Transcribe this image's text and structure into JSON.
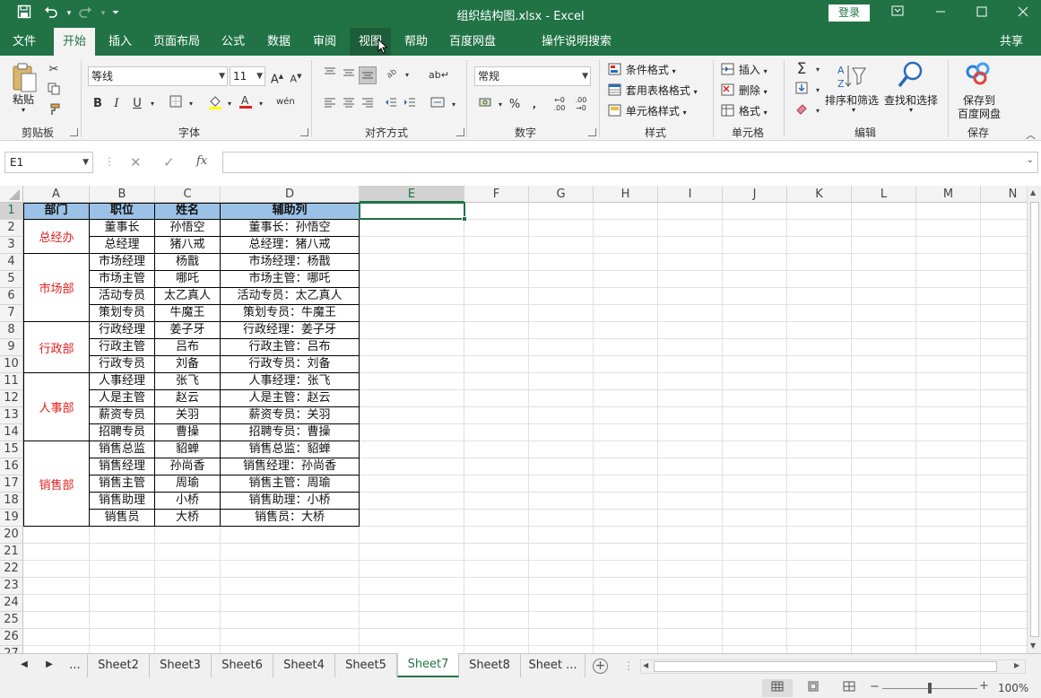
{
  "titlebar": {
    "title": "组织结构图.xlsx  -  Excel",
    "login_label": "登录",
    "save_icon": "save-icon",
    "undo_icon": "undo-icon",
    "redo_icon": "redo-icon"
  },
  "tabs": [
    {
      "label": "文件"
    },
    {
      "label": "开始"
    },
    {
      "label": "插入"
    },
    {
      "label": "页面布局"
    },
    {
      "label": "公式"
    },
    {
      "label": "数据"
    },
    {
      "label": "审阅"
    },
    {
      "label": "视图"
    },
    {
      "label": "帮助"
    },
    {
      "label": "百度网盘"
    },
    {
      "label": "操作说明搜索"
    }
  ],
  "share_label": "共享",
  "ribbon": {
    "clipboard": {
      "paste": "粘贴",
      "group": "剪贴板"
    },
    "font": {
      "name": "等线",
      "size": "11",
      "bold": "B",
      "italic": "I",
      "underline": "U",
      "group": "字体"
    },
    "alignment": {
      "group": "对齐方式"
    },
    "number": {
      "format": "常规",
      "group": "数字"
    },
    "styles": {
      "conditional": "条件格式",
      "table": "套用表格格式",
      "cell": "单元格样式",
      "group": "样式"
    },
    "cells": {
      "insert": "插入",
      "delete": "删除",
      "format": "格式",
      "group": "单元格"
    },
    "editing": {
      "sort": "排序和筛选",
      "find": "查找和选择",
      "group": "编辑"
    },
    "save": {
      "label1": "保存到",
      "label2": "百度网盘",
      "group": "保存"
    }
  },
  "formulabar": {
    "namebox": "E1",
    "value": ""
  },
  "columns": [
    "A",
    "B",
    "C",
    "D",
    "E",
    "F",
    "G",
    "H",
    "I",
    "J",
    "K",
    "L",
    "M",
    "N"
  ],
  "rows": [
    "1",
    "2",
    "3",
    "4",
    "5",
    "6",
    "7",
    "8",
    "9",
    "10",
    "11",
    "12",
    "13",
    "14",
    "15",
    "16",
    "17",
    "18",
    "19",
    "20",
    "21",
    "22",
    "23",
    "24",
    "25",
    "26",
    "27"
  ],
  "table": {
    "headers": [
      "部门",
      "职位",
      "姓名",
      "辅助列"
    ],
    "departments": [
      "总经办",
      "市场部",
      "行政部",
      "人事部",
      "销售部"
    ],
    "rows": [
      [
        "董事长",
        "孙悟空",
        "董事长：孙悟空"
      ],
      [
        "总经理",
        "猪八戒",
        "总经理：猪八戒"
      ],
      [
        "市场经理",
        "杨戬",
        "市场经理：杨戬"
      ],
      [
        "市场主管",
        "哪吒",
        "市场主管：哪吒"
      ],
      [
        "活动专员",
        "太乙真人",
        "活动专员：太乙真人"
      ],
      [
        "策划专员",
        "牛魔王",
        "策划专员：牛魔王"
      ],
      [
        "行政经理",
        "姜子牙",
        "行政经理：姜子牙"
      ],
      [
        "行政主管",
        "吕布",
        "行政主管：吕布"
      ],
      [
        "行政专员",
        "刘备",
        "行政专员：刘备"
      ],
      [
        "人事经理",
        "张飞",
        "人事经理：张飞"
      ],
      [
        "人是主管",
        "赵云",
        "人是主管：赵云"
      ],
      [
        "薪资专员",
        "关羽",
        "薪资专员：关羽"
      ],
      [
        "招聘专员",
        "曹操",
        "招聘专员：曹操"
      ],
      [
        "销售总监",
        "貂蝉",
        "销售总监：貂蝉"
      ],
      [
        "销售经理",
        "孙尚香",
        "销售经理：孙尚香"
      ],
      [
        "销售主管",
        "周瑜",
        "销售主管：周瑜"
      ],
      [
        "销售助理",
        "小桥",
        "销售助理：小桥"
      ],
      [
        "销售员",
        "大桥",
        "销售员：大桥"
      ]
    ]
  },
  "sheets": [
    "Sheet2",
    "Sheet3",
    "Sheet6",
    "Sheet4",
    "Sheet5",
    "Sheet7",
    "Sheet8",
    "Sheet ..."
  ],
  "active_sheet": "Sheet7",
  "ellipsis": "...",
  "zoom": "100%",
  "colors": {
    "accent": "#217346",
    "header_fill": "#9bc2e6",
    "dept_text": "#e02020"
  }
}
